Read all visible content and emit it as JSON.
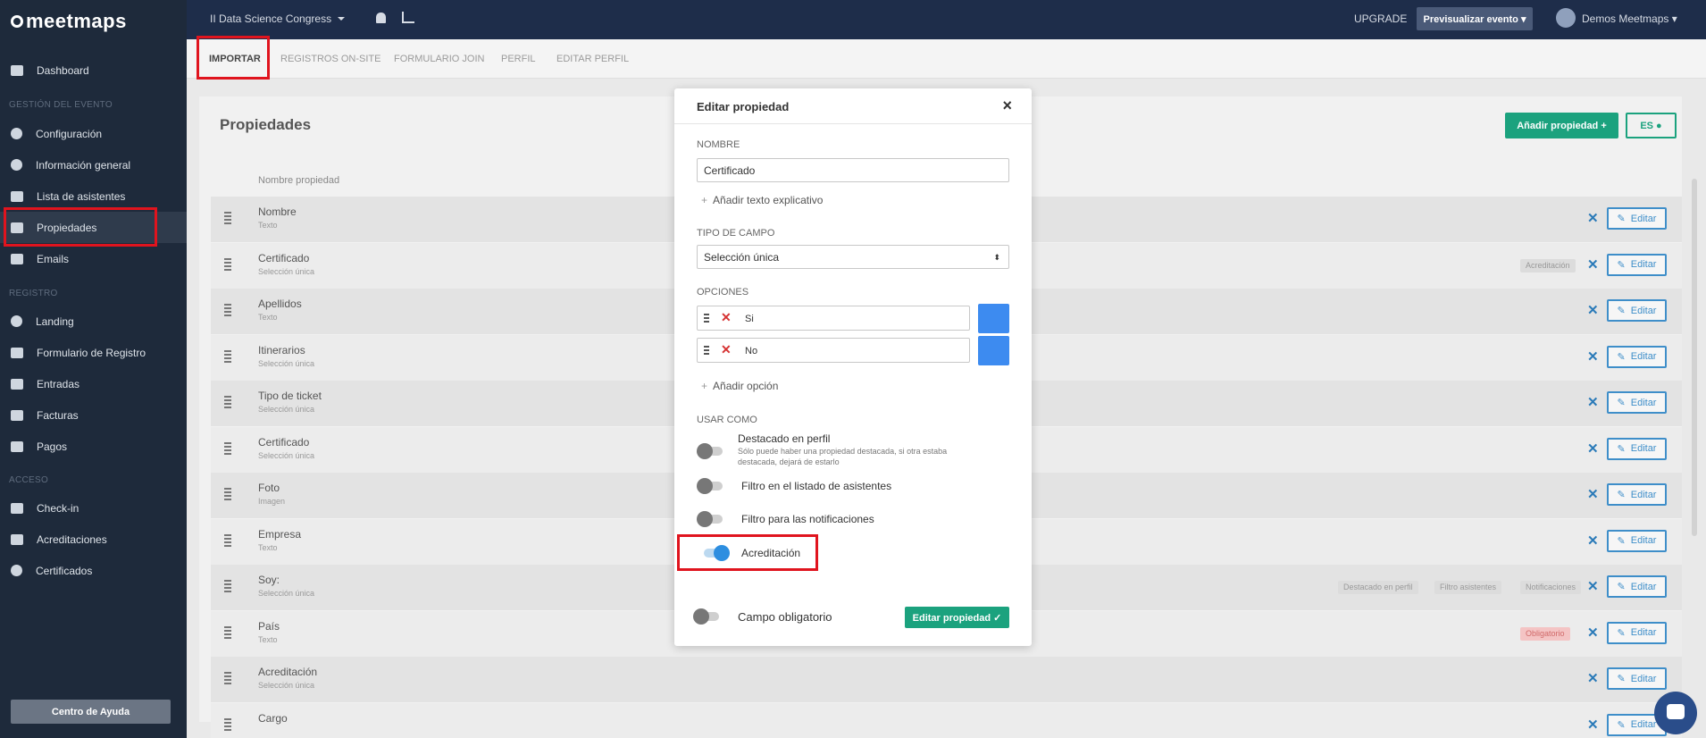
{
  "app": {
    "logo": "meetmaps"
  },
  "topbar": {
    "event": "II Data Science Congress",
    "upgrade": "UPGRADE",
    "preview": "Previsualizar evento ▾",
    "user": "Demos Meetmaps ▾"
  },
  "sidebar": {
    "dashboard": "Dashboard",
    "section_event": "GESTIÓN DEL EVENTO",
    "items_event": [
      "Configuración",
      "Información general",
      "Lista de asistentes",
      "Propiedades",
      "Emails"
    ],
    "section_registro": "REGISTRO",
    "items_registro": [
      "Landing",
      "Formulario de Registro",
      "Entradas",
      "Facturas",
      "Pagos"
    ],
    "section_acceso": "ACCESO",
    "items_acceso": [
      "Check-in",
      "Acreditaciones",
      "Certificados"
    ],
    "help": "Centro de Ayuda"
  },
  "tabs": [
    "IMPORTAR",
    "REGISTROS ON-SITE",
    "FORMULARIO JOIN",
    "PERFIL",
    "EDITAR PERFIL"
  ],
  "page": {
    "title": "Propiedades",
    "add_button": "Añadir propiedad +",
    "lang_button": "ES ●",
    "col_header": "Nombre propiedad",
    "edit_label": "Editar",
    "rows": [
      {
        "name": "Nombre",
        "type": "Texto",
        "tags": []
      },
      {
        "name": "Certificado",
        "type": "Selección única",
        "tags": [
          "Acreditación"
        ]
      },
      {
        "name": "Apellidos",
        "type": "Texto",
        "tags": []
      },
      {
        "name": "Itinerarios",
        "type": "Selección única",
        "tags": []
      },
      {
        "name": "Tipo de ticket",
        "type": "Selección única",
        "tags": []
      },
      {
        "name": "Certificado",
        "type": "Selección única",
        "tags": []
      },
      {
        "name": "Foto",
        "type": "Imagen",
        "tags": []
      },
      {
        "name": "Empresa",
        "type": "Texto",
        "tags": []
      },
      {
        "name": "Soy:",
        "type": "Selección única",
        "tags": [
          "Destacado en perfil",
          "Filtro asistentes",
          "Notificaciones"
        ]
      },
      {
        "name": "País",
        "type": "Texto",
        "tags": [
          "Obligatorio"
        ]
      },
      {
        "name": "Acreditación",
        "type": "Selección única",
        "tags": []
      },
      {
        "name": "Cargo",
        "type": "",
        "tags": []
      }
    ]
  },
  "modal": {
    "title": "Editar propiedad",
    "close": "×",
    "nombre_label": "NOMBRE",
    "nombre_value": "Certificado",
    "add_help": "Añadir texto explicativo",
    "tipo_label": "TIPO DE CAMPO",
    "tipo_value": "Selección única",
    "opciones_label": "OPCIONES",
    "options": [
      "Si",
      "No"
    ],
    "add_option": "Añadir opción",
    "usar_label": "USAR COMO",
    "toggles": {
      "destacado": {
        "label": "Destacado en perfil",
        "note": "Sólo puede haber una propiedad destacada, si otra estaba destacada, dejará de estarlo",
        "on": false
      },
      "filtro_listado": {
        "label": "Filtro en el listado de asistentes",
        "on": false
      },
      "filtro_notif": {
        "label": "Filtro para las notificaciones",
        "on": false
      },
      "acreditacion": {
        "label": "Acreditación",
        "on": true
      },
      "obligatorio": {
        "label": "Campo obligatorio",
        "on": false
      }
    },
    "submit": "Editar propiedad ✓"
  }
}
